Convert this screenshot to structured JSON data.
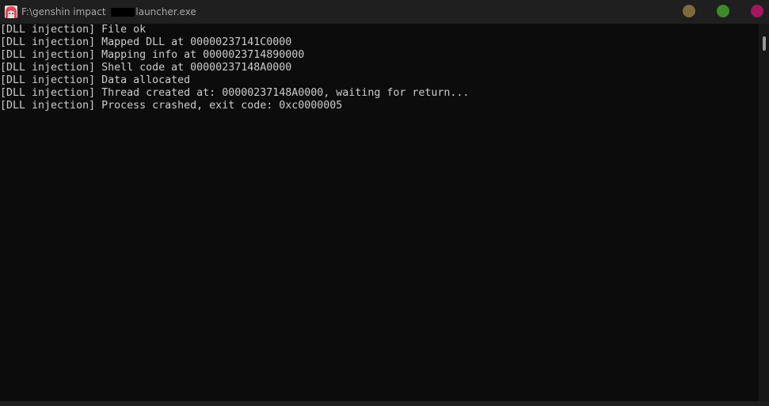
{
  "window": {
    "title_prefix": "F:\\genshin impact ",
    "title_suffix": "launcher.exe",
    "icon": "anime-avatar-icon"
  },
  "controls": {
    "minimize_color": "#7f6a3f",
    "maximize_color": "#3f8a2a",
    "close_color": "#a3175c"
  },
  "console": {
    "lines": [
      "[DLL injection] File ok",
      "[DLL injection] Mapped DLL at 00000237141C0000",
      "[DLL injection] Mapping info at 0000023714890000",
      "[DLL injection] Shell code at 00000237148A0000",
      "[DLL injection] Data allocated",
      "[DLL injection] Thread created at: 00000237148A0000, waiting for return...",
      "[DLL injection] Process crashed, exit code: 0xc0000005"
    ]
  }
}
